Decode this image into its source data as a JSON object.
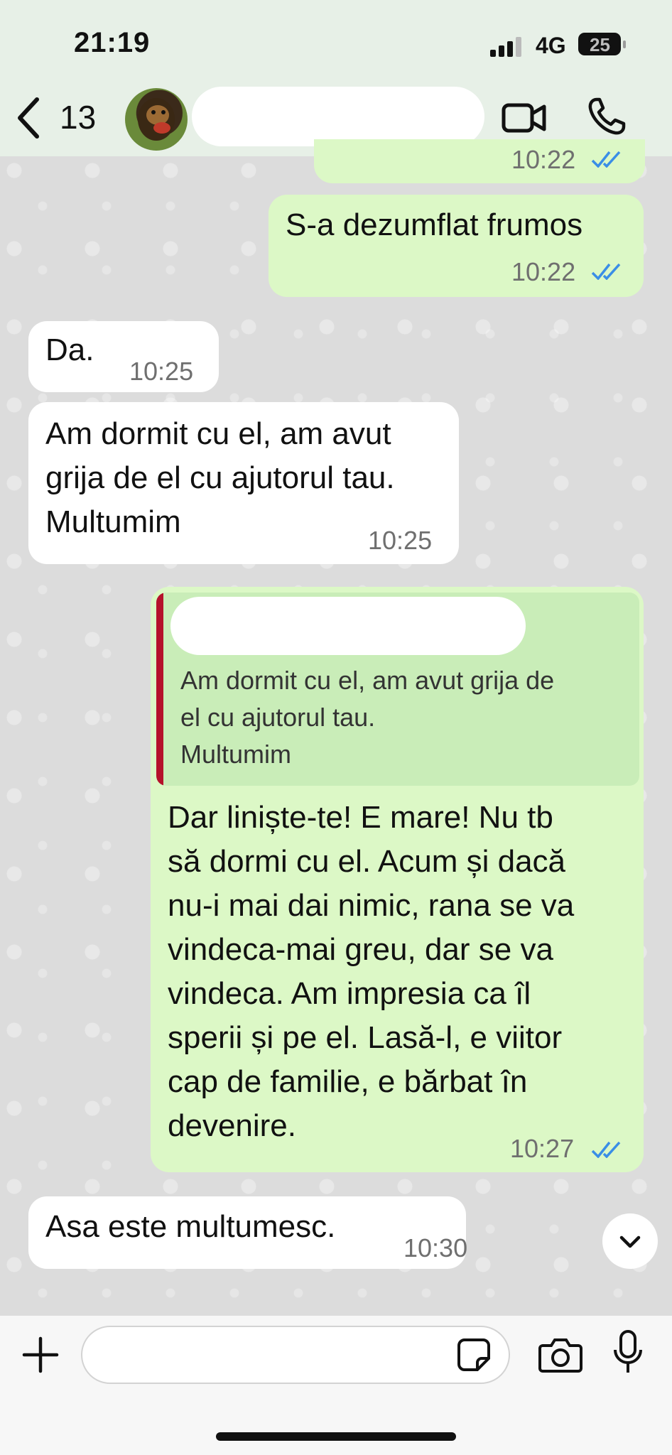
{
  "status": {
    "time": "21:19",
    "network": "4G",
    "battery": "25"
  },
  "header": {
    "back_count": "13"
  },
  "messages": [
    {
      "dir": "out",
      "text": "",
      "time": "10:22"
    },
    {
      "dir": "out",
      "text": "S-a dezumflat frumos",
      "time": "10:22"
    },
    {
      "dir": "in",
      "text": "Da.",
      "time": "10:25"
    },
    {
      "dir": "in",
      "text": "Am dormit cu el, am avut\ngrija de el cu ajutorul tau.\nMultumim",
      "time": "10:25"
    },
    {
      "dir": "out",
      "quote": "Am dormit cu el, am avut grija de\nel cu ajutorul tau.\nMultumim",
      "text": "Dar liniște-te! E mare! Nu tb\nsă dormi cu el. Acum și dacă\nnu-i mai dai nimic, rana se va\nvindeca-mai greu, dar se va\nvindeca. Am impresia ca îl\nsperii și pe el. Lasă-l, e viitor\ncap de familie, e bărbat în\ndevenire.",
      "time": "10:27"
    },
    {
      "dir": "in",
      "text": "Asa este multumesc.",
      "time": "10:30"
    }
  ],
  "colors": {
    "outgoing": "#dcf8c6",
    "incoming": "#ffffff",
    "tick": "#3a8ee6",
    "quote_bar": "#b5122b"
  },
  "icons": [
    "back-chevron",
    "video-camera",
    "phone",
    "scroll-down-chevron",
    "plus",
    "sticker",
    "camera",
    "microphone"
  ]
}
